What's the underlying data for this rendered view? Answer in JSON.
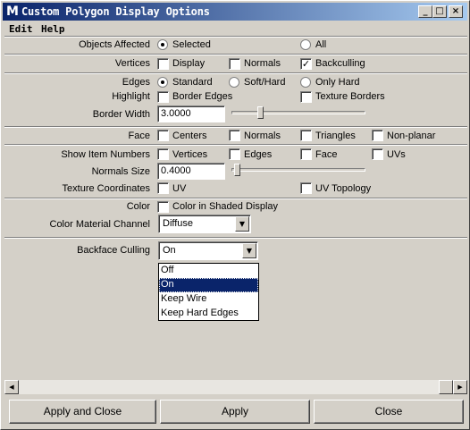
{
  "window": {
    "title": "Custom Polygon Display Options",
    "app_icon": "maya-icon",
    "minimize_glyph": "_",
    "maximize_glyph": "□",
    "close_glyph": "×"
  },
  "menu": {
    "edit": "Edit",
    "help": "Help"
  },
  "objects_affected": {
    "label": "Objects Affected",
    "selected": "Selected",
    "all": "All",
    "value": "Selected"
  },
  "vertices": {
    "label": "Vertices",
    "display": "Display",
    "normals": "Normals",
    "backculling": "Backculling",
    "backculling_checked": true
  },
  "edges": {
    "label": "Edges",
    "standard": "Standard",
    "soft_hard": "Soft/Hard",
    "only_hard": "Only Hard",
    "value": "Standard"
  },
  "highlight": {
    "label": "Highlight",
    "border_edges": "Border Edges",
    "texture_borders": "Texture Borders"
  },
  "border_width": {
    "label": "Border Width",
    "value": "3.0000",
    "slider_fraction": 0.2
  },
  "face": {
    "label": "Face",
    "centers": "Centers",
    "normals": "Normals",
    "triangles": "Triangles",
    "non_planar": "Non-planar"
  },
  "show_item_numbers": {
    "label": "Show Item Numbers",
    "vertices": "Vertices",
    "edges": "Edges",
    "face": "Face",
    "uvs": "UVs"
  },
  "normals_size": {
    "label": "Normals Size",
    "value": "0.4000",
    "slider_fraction": 0.02
  },
  "texture_coordinates": {
    "label": "Texture Coordinates",
    "uv": "UV",
    "uv_topology": "UV Topology"
  },
  "color": {
    "label": "Color",
    "color_in_shaded": "Color in Shaded Display"
  },
  "color_material_channel": {
    "label": "Color Material Channel",
    "value": "Diffuse"
  },
  "backface_culling": {
    "label": "Backface Culling",
    "value": "On",
    "options": [
      "Off",
      "On",
      "Keep Wire",
      "Keep Hard Edges"
    ],
    "selected_index": 1
  },
  "check_glyph": "✓",
  "arrow_down": "▼",
  "arrow_left": "◀",
  "arrow_right": "▶",
  "buttons": {
    "apply_and_close": "Apply and Close",
    "apply": "Apply",
    "close": "Close"
  }
}
